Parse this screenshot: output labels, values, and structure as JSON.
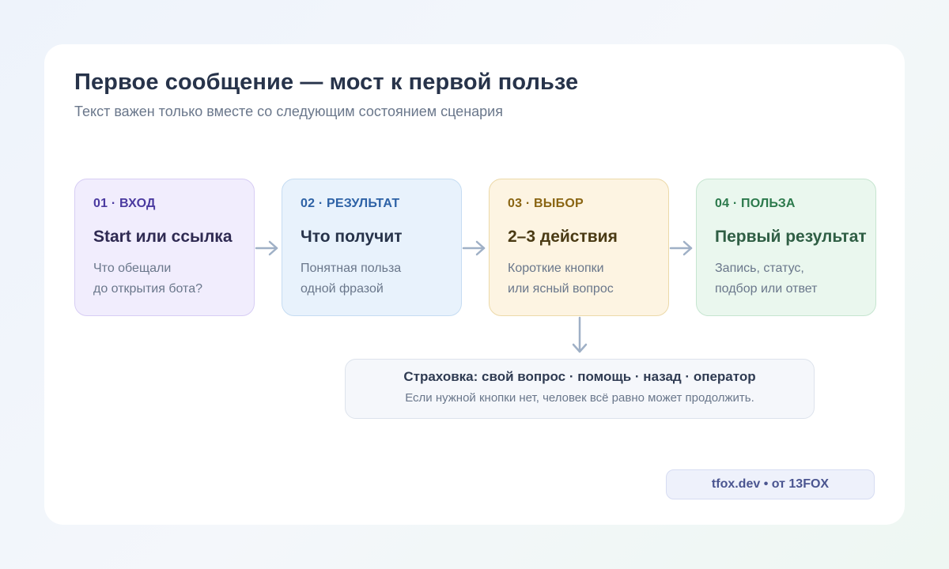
{
  "header": {
    "title": "Первое сообщение — мост к первой пользе",
    "subtitle": "Текст важен только вместе со следующим состоянием сценария"
  },
  "steps": [
    {
      "tag": "01 · ВХОД",
      "title": "Start или ссылка",
      "desc_line1": "Что обещали",
      "desc_line2": "до открытия бота?"
    },
    {
      "tag": "02 · РЕЗУЛЬТАТ",
      "title": "Что получит",
      "desc_line1": "Понятная польза",
      "desc_line2": "одной фразой"
    },
    {
      "tag": "03 · ВЫБОР",
      "title": "2–3 действия",
      "desc_line1": "Короткие кнопки",
      "desc_line2": "или ясный вопрос"
    },
    {
      "tag": "04 · ПОЛЬЗА",
      "title": "Первый результат",
      "desc_line1": "Запись, статус,",
      "desc_line2": "подбор или ответ"
    }
  ],
  "fallback": {
    "title": "Страховка: свой вопрос · помощь · назад · оператор",
    "desc": "Если нужной кнопки нет, человек всё равно может продолжить."
  },
  "brand": {
    "label": "tfox.dev • от 13FOX"
  },
  "colors": {
    "connector": "#9fb0c6",
    "step_1": "#f1edfd",
    "step_2": "#e8f2fc",
    "step_3": "#fdf4e2",
    "step_4": "#eaf7ee"
  }
}
